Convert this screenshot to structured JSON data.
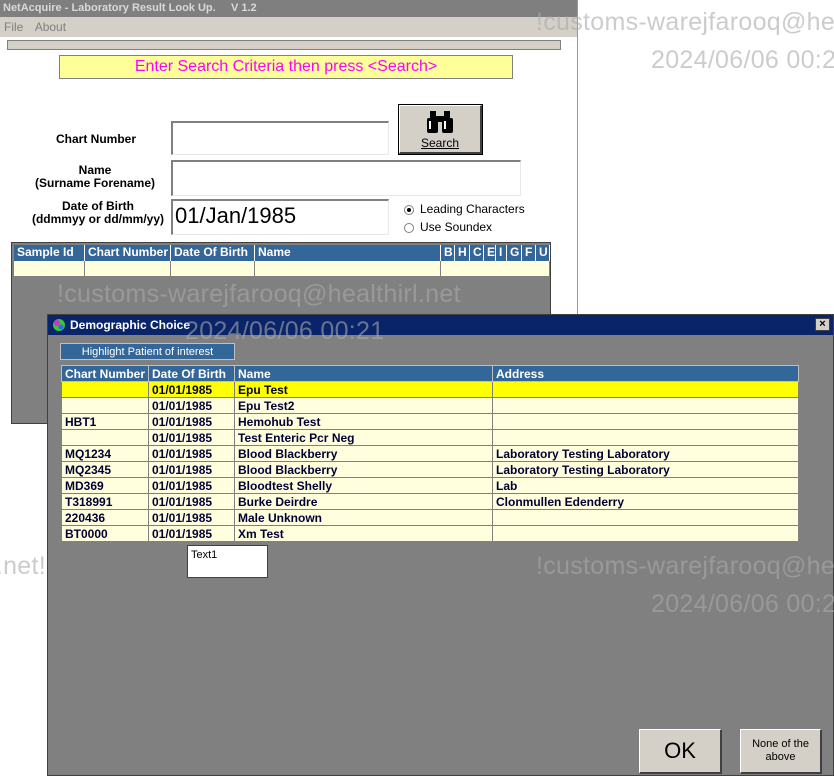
{
  "main": {
    "title": "NetAcquire - Laboratory Result Look Up.     V 1.2",
    "menu": [
      "File",
      "About"
    ],
    "prompt": "Enter Search Criteria then press <Search>",
    "labels": {
      "chart_number": "Chart Number",
      "name_line1": "Name",
      "name_line2": "(Surname Forename)",
      "dob_line1": "Date of Birth",
      "dob_line2": "(ddmmyy or dd/mm/yy)"
    },
    "fields": {
      "chart_number": "",
      "name": "",
      "dob": "01/Jan/1985"
    },
    "search_label": "Search",
    "radios": [
      {
        "label": "Leading Characters",
        "checked": true
      },
      {
        "label": "Use Soundex",
        "checked": false
      }
    ],
    "grid_headers": [
      "Sample Id",
      "Chart Number",
      "Date Of Birth",
      "Name",
      "B",
      "H",
      "C",
      "E",
      "I",
      "G",
      "F",
      "U"
    ]
  },
  "dialog": {
    "title": "Demographic Choice",
    "close": "×",
    "highlight_label": "Highlight Patient of interest",
    "columns": [
      "Chart Number",
      "Date Of Birth",
      "Name",
      "Address"
    ],
    "rows": [
      {
        "chart": "",
        "dob": "01/01/1985",
        "name": "Epu Test",
        "address": "",
        "selected": true
      },
      {
        "chart": "",
        "dob": "01/01/1985",
        "name": "Epu Test2",
        "address": ""
      },
      {
        "chart": "HBT1",
        "dob": "01/01/1985",
        "name": "Hemohub Test",
        "address": ""
      },
      {
        "chart": "",
        "dob": "01/01/1985",
        "name": "Test Enteric Pcr Neg",
        "address": ""
      },
      {
        "chart": "MQ1234",
        "dob": "01/01/1985",
        "name": "Blood Blackberry",
        "address": "Laboratory Testing Laboratory"
      },
      {
        "chart": "MQ2345",
        "dob": "01/01/1985",
        "name": "Blood Blackberry",
        "address": "Laboratory Testing Laboratory"
      },
      {
        "chart": "MD369",
        "dob": "01/01/1985",
        "name": "Bloodtest Shelly",
        "address": "Lab"
      },
      {
        "chart": "T318991",
        "dob": "01/01/1985",
        "name": "Burke Deirdre",
        "address": "Clonmullen Edenderry"
      },
      {
        "chart": "220436",
        "dob": "01/01/1985",
        "name": "Male Unknown",
        "address": ""
      },
      {
        "chart": "BT0000",
        "dob": "01/01/1985",
        "name": "Xm Test",
        "address": ""
      }
    ],
    "text1": "Text1",
    "ok_label": "OK",
    "none_line1": "None of the",
    "none_line2": "above"
  },
  "watermarks": [
    {
      "text": "!customs-warejfarooq@healthirl.net"
    },
    {
      "text": "2024/06/06 00:21"
    }
  ],
  "colors": {
    "header_blue": "#336699",
    "row_cream": "#ffffdd",
    "selected_row": "#ffff00",
    "prompt_text": "#ff00ff",
    "dialog_title": "#0a246a"
  }
}
